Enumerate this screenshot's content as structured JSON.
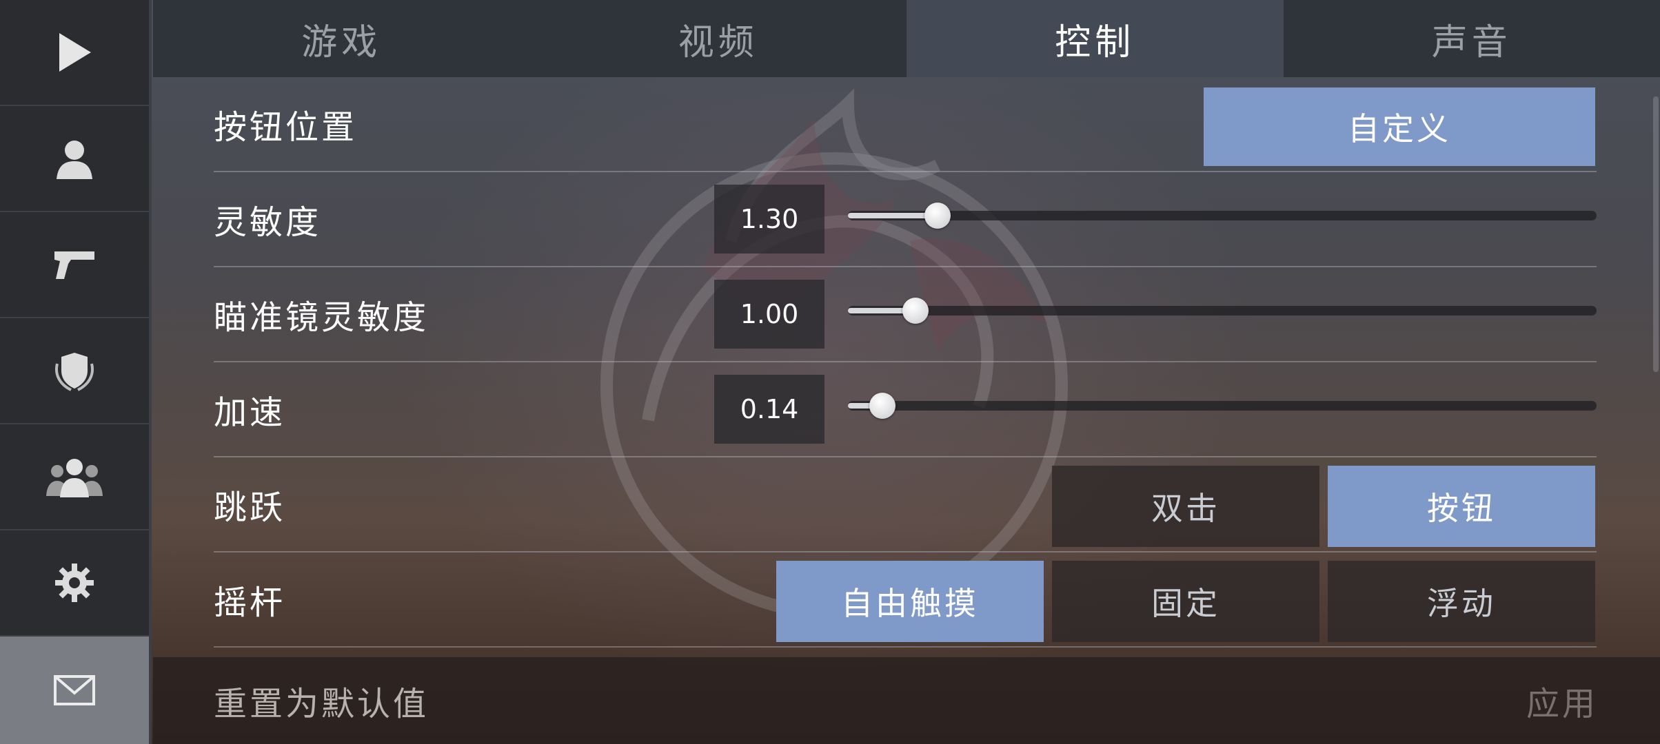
{
  "sidebar": {
    "items": [
      {
        "icon": "play-icon",
        "active": false
      },
      {
        "icon": "profile-icon",
        "active": false
      },
      {
        "icon": "pistol-icon",
        "active": false
      },
      {
        "icon": "shield-laurel-icon",
        "active": false
      },
      {
        "icon": "friends-icon",
        "active": false
      },
      {
        "icon": "gear-icon",
        "active": false
      },
      {
        "icon": "mail-icon",
        "active": true
      }
    ]
  },
  "tabs": [
    {
      "label": "游戏",
      "active": false
    },
    {
      "label": "视频",
      "active": false
    },
    {
      "label": "控制",
      "active": true
    },
    {
      "label": "声音",
      "active": false
    }
  ],
  "settings": {
    "button_position": {
      "label": "按钮位置",
      "button": "自定义"
    },
    "sensitivity": {
      "label": "灵敏度",
      "value": "1.30",
      "fraction": 0.12
    },
    "scope_sensitivity": {
      "label": "瞄准镜灵敏度",
      "value": "1.00",
      "fraction": 0.09
    },
    "acceleration": {
      "label": "加速",
      "value": "0.14",
      "fraction": 0.046
    },
    "jump": {
      "label": "跳跃",
      "options": [
        "双击",
        "按钮"
      ],
      "selected": "按钮"
    },
    "joystick": {
      "label": "摇杆",
      "options": [
        "自由触摸",
        "固定",
        "浮动"
      ],
      "selected": "自由触摸"
    }
  },
  "footer": {
    "reset_label": "重置为默认值",
    "apply_label": "应用"
  },
  "colors": {
    "accent": "#7f99c9",
    "sidebar_bg": "#2b2d31",
    "active_tab": "#434a55"
  }
}
